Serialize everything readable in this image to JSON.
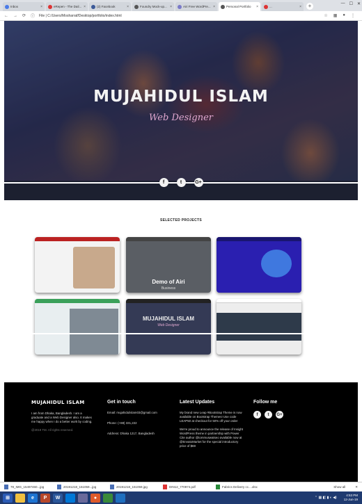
{
  "browser": {
    "tabs": [
      {
        "label": "Inbox",
        "color": "#4a7be8"
      },
      {
        "label": "eRepen - The Dail...",
        "color": "#d33"
      },
      {
        "label": "(2) Facebook",
        "color": "#3b5998"
      },
      {
        "label": "Foundry Mock-up...",
        "color": "#555"
      },
      {
        "label": "Airi Free WordPre...",
        "color": "#7a7ac8"
      },
      {
        "label": "Personal Portfolio",
        "color": "#555",
        "active": true
      },
      {
        "label": "...",
        "color": "#d33"
      }
    ],
    "new_tab": "+",
    "url": "File | C:/Users/Mosharraf/Desktop/portfolio/index.html"
  },
  "hero": {
    "title": "MUJAHIDUL ISLAM",
    "subtitle": "Web Designer",
    "social": [
      "f",
      "t",
      "G+"
    ]
  },
  "projects": {
    "title": "SELECTED PROJECTS",
    "cards": [
      {
        "name": "project-card-1"
      },
      {
        "name": "project-card-2",
        "label": "Demo of Airi",
        "sub": "Business"
      },
      {
        "name": "project-card-3"
      },
      {
        "name": "project-card-4"
      },
      {
        "name": "project-card-5",
        "label": "MUJAHIDUL ISLAM",
        "sub": "Web Designer"
      },
      {
        "name": "project-card-6"
      }
    ]
  },
  "footer": {
    "about": {
      "brand": "MUJAHIDUL ISLAM",
      "text": "I am from Dhaka, Bangladesh. I am a graduate and a Web Designer also. It makes me happy when I do a better work by coding.",
      "copyright": "@2019 TM. All rights reserved."
    },
    "contact": {
      "title": "Get in touch",
      "email": "Email: mujahidulislam03@gmail.com",
      "phone": "Phone: (+88) 331,222",
      "address": "Address: Dhaka 1217, Bangladesh"
    },
    "updates": {
      "title": "Latest Updates",
      "p1": "My brand new Leap #Bootstrap Theme is now available on Bootstrap Themes! Use code LEAP50 at checkout for 50% off your order",
      "p2": "We're proud to announce the release of Insight WordPress theme in partnership with Power Cite author @tommuswatseo available now at @EnvatoMarket for the special introductory price of $69"
    },
    "follow": {
      "title": "Follow me",
      "social": [
        "f",
        "t",
        "G+"
      ]
    }
  },
  "downloads": {
    "items": [
      "78_IMG_15497460...jpg",
      "20191218_151059...jpg",
      "20191218_151059.jpg",
      "DIN12_770974.pdf",
      "Fabrics Delivery cc....xlsx"
    ],
    "show_all": "Show all"
  },
  "taskbar": {
    "time": "4:53 PM",
    "date": "12-Jun-19"
  }
}
